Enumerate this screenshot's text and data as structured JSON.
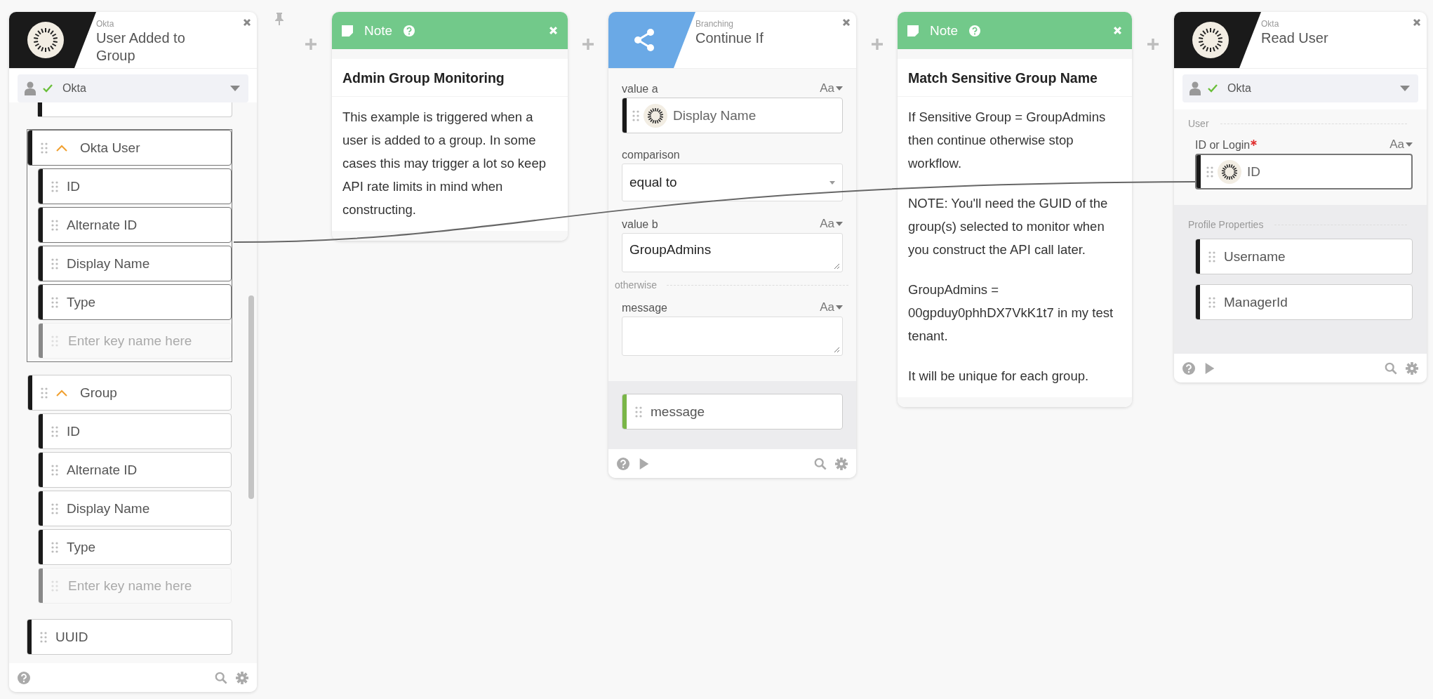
{
  "cards": [
    {
      "kind": "app_event",
      "app": "Okta",
      "title": "User Added to Group",
      "connection": {
        "name": "Okta",
        "verified": true
      },
      "runnable": false,
      "outputs": [
        {
          "kind": "group",
          "label": "Okta User",
          "expanded": true,
          "selected": true,
          "children": [
            {
              "label": "ID"
            },
            {
              "label": "Alternate ID"
            },
            {
              "label": "Display Name"
            },
            {
              "label": "Type"
            }
          ],
          "placeholder": "Enter key name here"
        },
        {
          "kind": "group",
          "label": "Group",
          "expanded": true,
          "selected": false,
          "children": [
            {
              "label": "ID"
            },
            {
              "label": "Alternate ID"
            },
            {
              "label": "Display Name"
            },
            {
              "label": "Type"
            }
          ],
          "placeholder": "Enter key name here"
        },
        {
          "kind": "field",
          "label": "UUID"
        }
      ]
    },
    {
      "kind": "note",
      "title": "Note",
      "heading": "Admin Group Monitoring",
      "paragraphs": [
        "This example is triggered when a user is added to a group. In some cases this may trigger a lot so keep API rate limits in mind when constructing."
      ]
    },
    {
      "kind": "function",
      "category": "Branching",
      "title": "Continue If",
      "runnable": true,
      "inputs": [
        {
          "kind": "mapped",
          "label": "value a",
          "type_toggle": "Aa",
          "value": "Display Name"
        },
        {
          "kind": "select",
          "label": "comparison",
          "value": "equal to"
        },
        {
          "kind": "textarea",
          "label": "value b",
          "type_toggle": "Aa",
          "value": "GroupAdmins"
        }
      ],
      "otherwise": {
        "label": "otherwise",
        "inputs": [
          {
            "kind": "textarea",
            "label": "message",
            "type_toggle": "Aa"
          }
        ]
      },
      "outputs": [
        {
          "label": "message"
        }
      ]
    },
    {
      "kind": "note",
      "title": "Note",
      "heading": "Match Sensitive Group Name",
      "paragraphs": [
        "If Sensitive Group = GroupAdmins then continue otherwise stop workflow.",
        "NOTE: You'll need the GUID of the group(s) selected to monitor when you construct the API call later.",
        "GroupAdmins = 00gpduy0phhDX7VkK1t7 in my test tenant.",
        "It will be unique for each group."
      ]
    },
    {
      "kind": "app_action",
      "app": "Okta",
      "title": "Read User",
      "connection": {
        "name": "Okta",
        "verified": true
      },
      "runnable": true,
      "sections": [
        {
          "kind": "inputs",
          "title": "User",
          "inputs": [
            {
              "label": "ID or Login",
              "required": true,
              "type_toggle": "Aa",
              "value": "ID"
            }
          ]
        },
        {
          "kind": "outputs",
          "title": "Profile Properties",
          "fields": [
            {
              "label": "Username"
            },
            {
              "label": "ManagerId"
            }
          ]
        }
      ]
    }
  ]
}
